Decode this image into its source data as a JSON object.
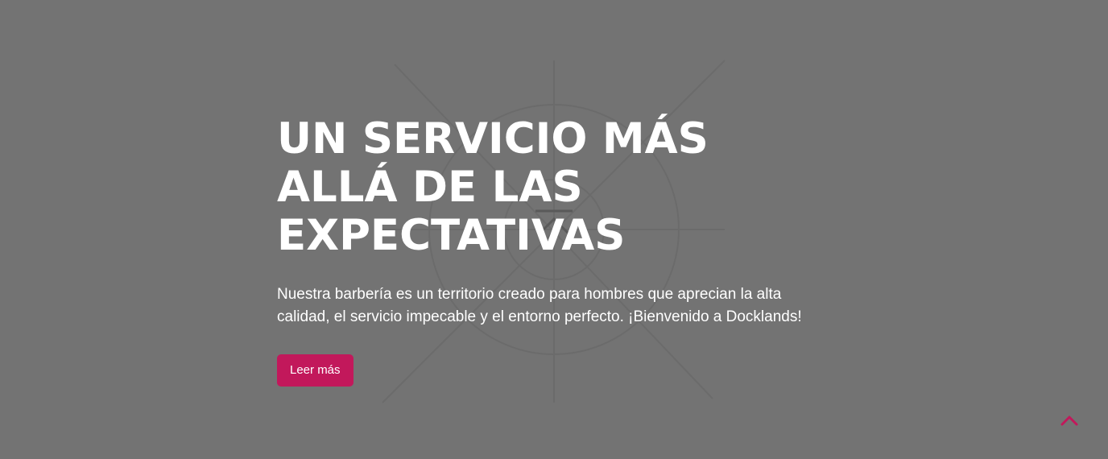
{
  "hero": {
    "title_lines": [
      "UN SERVICIO MÁS",
      "ALLÁ DE LAS",
      "EXPECTATIVAS"
    ],
    "description": "Nuestra barbería es un territorio creado para hombres que aprecian la alta calidad, el servicio impecable y el entorno perfecto. ¡Bienvenido a Docklands!",
    "cta_label": "Leer más",
    "background_image": "barbershop-emblem-watermark"
  },
  "scroll_to_top": {
    "icon": "chevron-up-icon"
  },
  "colors": {
    "background": "#737373",
    "accent": "#c2185b",
    "text": "#ffffff"
  }
}
